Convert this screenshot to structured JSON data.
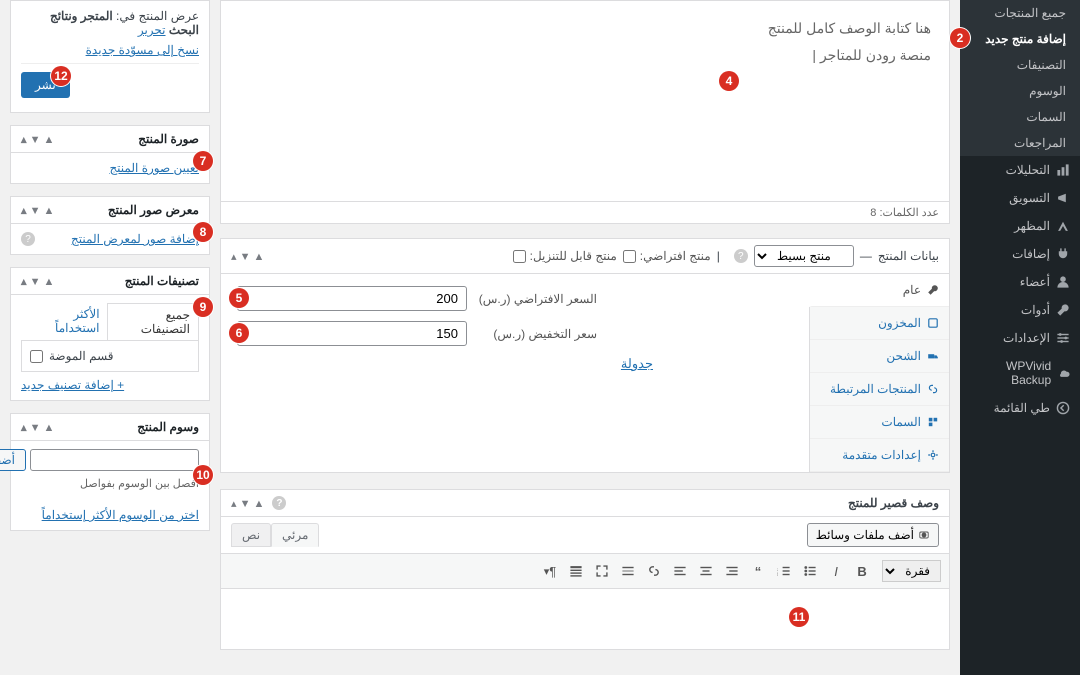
{
  "sidebar": {
    "items": [
      {
        "label": "جميع المنتجات"
      },
      {
        "label": "إضافة منتج جديد",
        "active": true
      },
      {
        "label": "التصنيفات"
      },
      {
        "label": "الوسوم"
      },
      {
        "label": "السمات"
      },
      {
        "label": "المراجعات"
      }
    ],
    "menu": [
      {
        "label": "التحليلات"
      },
      {
        "label": "التسويق"
      },
      {
        "label": "المظهر"
      },
      {
        "label": "إضافات"
      },
      {
        "label": "أعضاء"
      },
      {
        "label": "أدوات"
      },
      {
        "label": "الإعدادات"
      },
      {
        "label": "WPVivid Backup"
      },
      {
        "label": "طي القائمة"
      }
    ]
  },
  "publish": {
    "display_in_label": "عرض المنتج في:",
    "display_in_value": "المتجر ونتائج البحث",
    "edit": "تحرير",
    "copy_draft": "نسخ إلى مسوّدة جديدة",
    "button": "نشر"
  },
  "boxes": {
    "image": {
      "title": "صورة المنتج",
      "link": "تعيين صورة المنتج"
    },
    "gallery": {
      "title": "معرض صور المنتج",
      "link": "إضافة صور لمعرض المنتج"
    },
    "categories": {
      "title": "تصنيفات المنتج",
      "tab_all": "جميع التصنيفات",
      "tab_most": "الأكثر استخداماً",
      "option": "قسم الموضة",
      "add": "+ إضافة تصنيف جديد"
    },
    "tags": {
      "title": "وسوم المنتج",
      "add_btn": "أضف",
      "hint": "افصل بين الوسوم بفواصل",
      "choose": "اختر من الوسوم الأكثر إستخداماً"
    }
  },
  "editor": {
    "line1": "هنا كتابة الوصف كامل للمنتج",
    "line2": "منصة رودن للمتاجر |",
    "word_count_label": "عدد الكلمات:",
    "word_count": "8"
  },
  "product_data": {
    "title": "بيانات المنتج",
    "type_label": "منتج بسيط",
    "virtual": "منتج افتراضي:",
    "downloadable": "منتج قابل للتنزيل:",
    "tabs": {
      "general": "عام",
      "inventory": "المخزون",
      "shipping": "الشحن",
      "linked": "المنتجات المرتبطة",
      "attributes": "السمات",
      "advanced": "إعدادات متقدمة"
    },
    "regular_label": "السعر الافتراضي (ر.س)",
    "regular_value": "200",
    "sale_label": "سعر التخفيض (ر.س)",
    "sale_value": "150",
    "schedule": "جدولة"
  },
  "short_desc": {
    "title": "وصف قصير للمنتج",
    "add_media": "أضف ملفات وسائط",
    "tab_visual": "مرئي",
    "tab_text": "نص",
    "format": "فقرة"
  },
  "annotations": {
    "2": "2",
    "4": "4",
    "5": "5",
    "6": "6",
    "7": "7",
    "8": "8",
    "9": "9",
    "10": "10",
    "11": "11",
    "12": "12"
  }
}
